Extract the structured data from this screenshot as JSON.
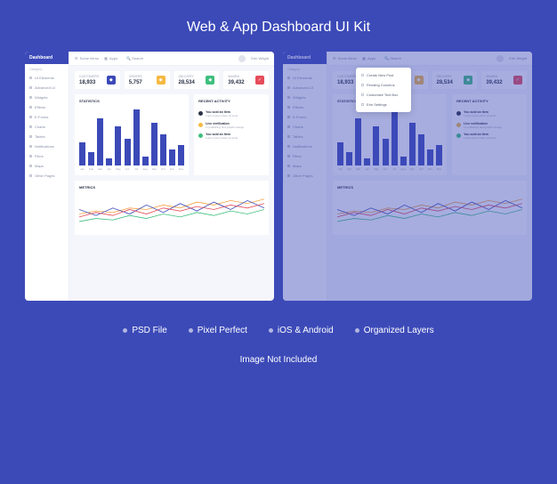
{
  "page_title": "Web & App Dashboard UI Kit",
  "footnote": "Image Not Included",
  "features": [
    "PSD File",
    "Pixel Perfect",
    "iOS & Android",
    "Organized Layers"
  ],
  "sidebar": {
    "brand": "Dashboard",
    "categories_label": "Category",
    "items": [
      "UI Elements",
      "Advanced UI",
      "Widgets",
      "Effects",
      "E-Forms",
      "Charts",
      "Tables",
      "Notifications",
      "Fliers",
      "Maps",
      "Other Pages"
    ]
  },
  "topbar": {
    "tabs": [
      "Some Menu",
      "Apps"
    ],
    "search": "Search",
    "user": "Erin Wright"
  },
  "metrics": [
    {
      "label": "CUSTOMERS",
      "value": "18,933"
    },
    {
      "label": "ORDERS",
      "value": "5,757"
    },
    {
      "label": "DELIVERY",
      "value": "28,534"
    },
    {
      "label": "MAMBU",
      "value": "39,432"
    }
  ],
  "statistics_title": "STATISTICS",
  "activity_title": "RECENT ACTIVITY",
  "activity": [
    {
      "title": "You sold an item",
      "sub": "Lorem ipsum dolor sit amet"
    },
    {
      "title": "Live verification",
      "sub": "In publishing and graphic design"
    },
    {
      "title": "You sold an item",
      "sub": "Lorem ipsum dolor sit amet"
    }
  ],
  "metrics_chart_title": "METRICS",
  "dropdown": [
    "Create New Post",
    "Pending Columns",
    "Customize Text Box",
    "Erin Settings"
  ],
  "chart_data": [
    {
      "type": "bar",
      "title": "STATISTICS",
      "categories": [
        "Jan",
        "Feb",
        "Mar",
        "Apr",
        "May",
        "Jun",
        "Jul",
        "Aug",
        "Sep",
        "Oct",
        "Nov",
        "Dec"
      ],
      "values": [
        38,
        22,
        78,
        12,
        64,
        44,
        92,
        14,
        70,
        52,
        26,
        34
      ],
      "ylim": [
        0,
        100
      ]
    },
    {
      "type": "line",
      "title": "METRICS",
      "x": [
        0,
        1,
        2,
        3,
        4,
        5,
        6,
        7,
        8,
        9,
        10,
        11
      ],
      "series": [
        {
          "name": "orange",
          "color": "#f5a142",
          "values": [
            22,
            26,
            24,
            30,
            28,
            34,
            30,
            38,
            34,
            40,
            36,
            42
          ]
        },
        {
          "name": "blue",
          "color": "#3c4ab8",
          "values": [
            28,
            20,
            30,
            22,
            34,
            24,
            36,
            26,
            38,
            28,
            40,
            30
          ]
        },
        {
          "name": "red",
          "color": "#e64c5a",
          "values": [
            18,
            24,
            20,
            28,
            22,
            30,
            26,
            32,
            28,
            34,
            30,
            36
          ]
        },
        {
          "name": "green",
          "color": "#3fbf7f",
          "values": [
            12,
            16,
            14,
            20,
            16,
            22,
            18,
            24,
            20,
            26,
            22,
            28
          ]
        }
      ],
      "ylim": [
        0,
        50
      ]
    }
  ]
}
